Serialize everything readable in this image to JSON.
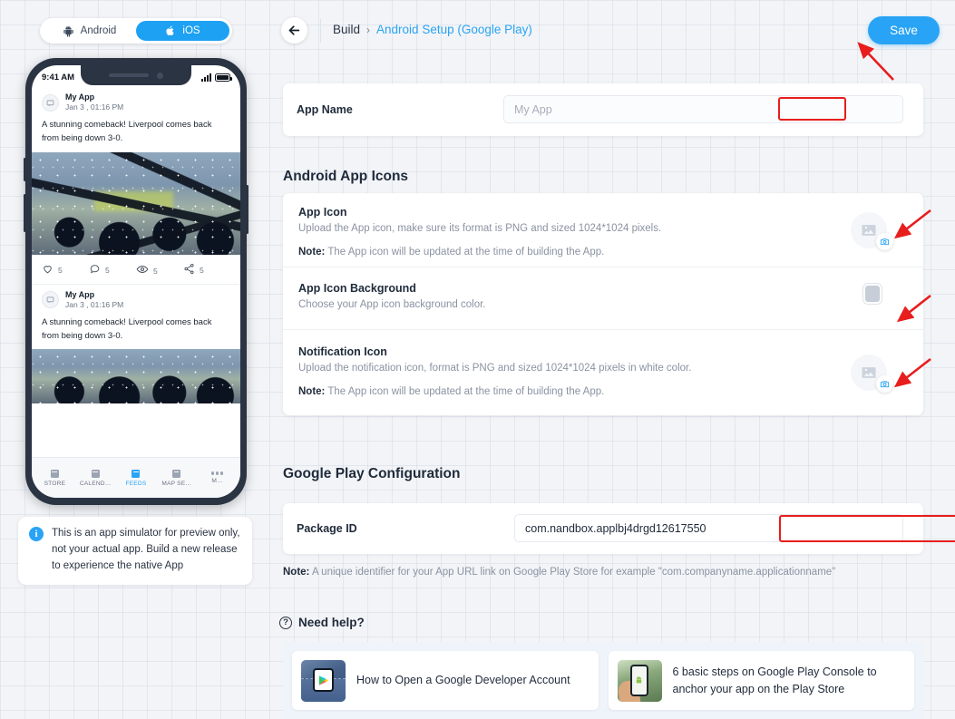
{
  "platform_toggle": {
    "android_label": "Android",
    "ios_label": "iOS",
    "active": "iOS",
    "active_color": "#1da1f2"
  },
  "simulator": {
    "status_time": "9:41 AM",
    "posts": [
      {
        "author": "My App",
        "timestamp": "Jan 3 , 01:16 PM",
        "text": "A stunning comeback! Liverpool comes back from being down 3-0.",
        "actions": [
          {
            "icon": "heart-icon",
            "count": "5"
          },
          {
            "icon": "comment-icon",
            "count": "5"
          },
          {
            "icon": "eye-icon",
            "count": "5"
          },
          {
            "icon": "share-icon",
            "count": "5"
          }
        ]
      },
      {
        "author": "My App",
        "timestamp": "Jan 3 , 01:16 PM",
        "text": "A stunning comeback! Liverpool comes back from being down 3-0."
      }
    ],
    "tabs": [
      {
        "label": "STORE",
        "icon": "store-icon",
        "active": false
      },
      {
        "label": "CALEND…",
        "icon": "calendar-icon",
        "active": false
      },
      {
        "label": "FEEDS",
        "icon": "feeds-icon",
        "active": true
      },
      {
        "label": "MAP SE…",
        "icon": "map-icon",
        "active": false
      },
      {
        "label": "M…",
        "icon": "more-dots-icon",
        "active": false
      }
    ],
    "active_tab_color": "#29a3f5",
    "note": "This is an app simulator for preview only, not your actual app. Build a new release to experience the native App"
  },
  "topbar": {
    "back_icon": "arrow-left-icon",
    "breadcrumb_root": "Build",
    "breadcrumb_sep": "›",
    "breadcrumb_current": "Android Setup (Google Play)",
    "save_label": "Save",
    "save_color": "#29a3f5"
  },
  "app_name": {
    "label": "App Name",
    "value": "",
    "placeholder": "My App"
  },
  "android_app_icons": {
    "section_title": "Android App Icons",
    "rows": [
      {
        "title": "App Icon",
        "desc": "Upload the App icon, make sure its format is PNG and sized 1024*1024 pixels.",
        "note_label": "Note:",
        "note_text": " The App icon will be updated at the time of building the App.",
        "control": "image-uploader"
      },
      {
        "title": "App Icon Background",
        "desc": "Choose your App icon background color.",
        "control": "color-swatch",
        "swatch_color": "#c8ced8"
      },
      {
        "title": "Notification Icon",
        "desc": "Upload the notification icon, format is PNG and sized 1024*1024 pixels in white color.",
        "note_label": "Note:",
        "note_text": " The App icon will be updated at the time of building the App.",
        "control": "image-uploader"
      }
    ]
  },
  "google_play": {
    "section_title": "Google Play Configuration",
    "package_label": "Package ID",
    "package_value": "com.nandbox.applbj4drgd12617550",
    "note_label": "Note:",
    "note_text": " A unique identifier for your App URL link on Google Play Store for example \"com.companyname.applicationname\""
  },
  "help": {
    "heading": "Need help?",
    "heading_icon": "question-circle-icon",
    "cards": [
      {
        "title": "How to Open a Google Developer Account",
        "thumb": "play-store-phone-in-pocket"
      },
      {
        "title": "6 basic steps on Google Play Console to anchor your app on the Play Store",
        "thumb": "hand-holding-android-phone"
      }
    ]
  },
  "annotations": {
    "color": "#e81d1d",
    "highlights": [
      "app-name-field",
      "package-id-field"
    ],
    "arrows": [
      "save-button",
      "app-icon-uploader",
      "app-icon-background-swatch",
      "notification-icon-uploader"
    ]
  }
}
